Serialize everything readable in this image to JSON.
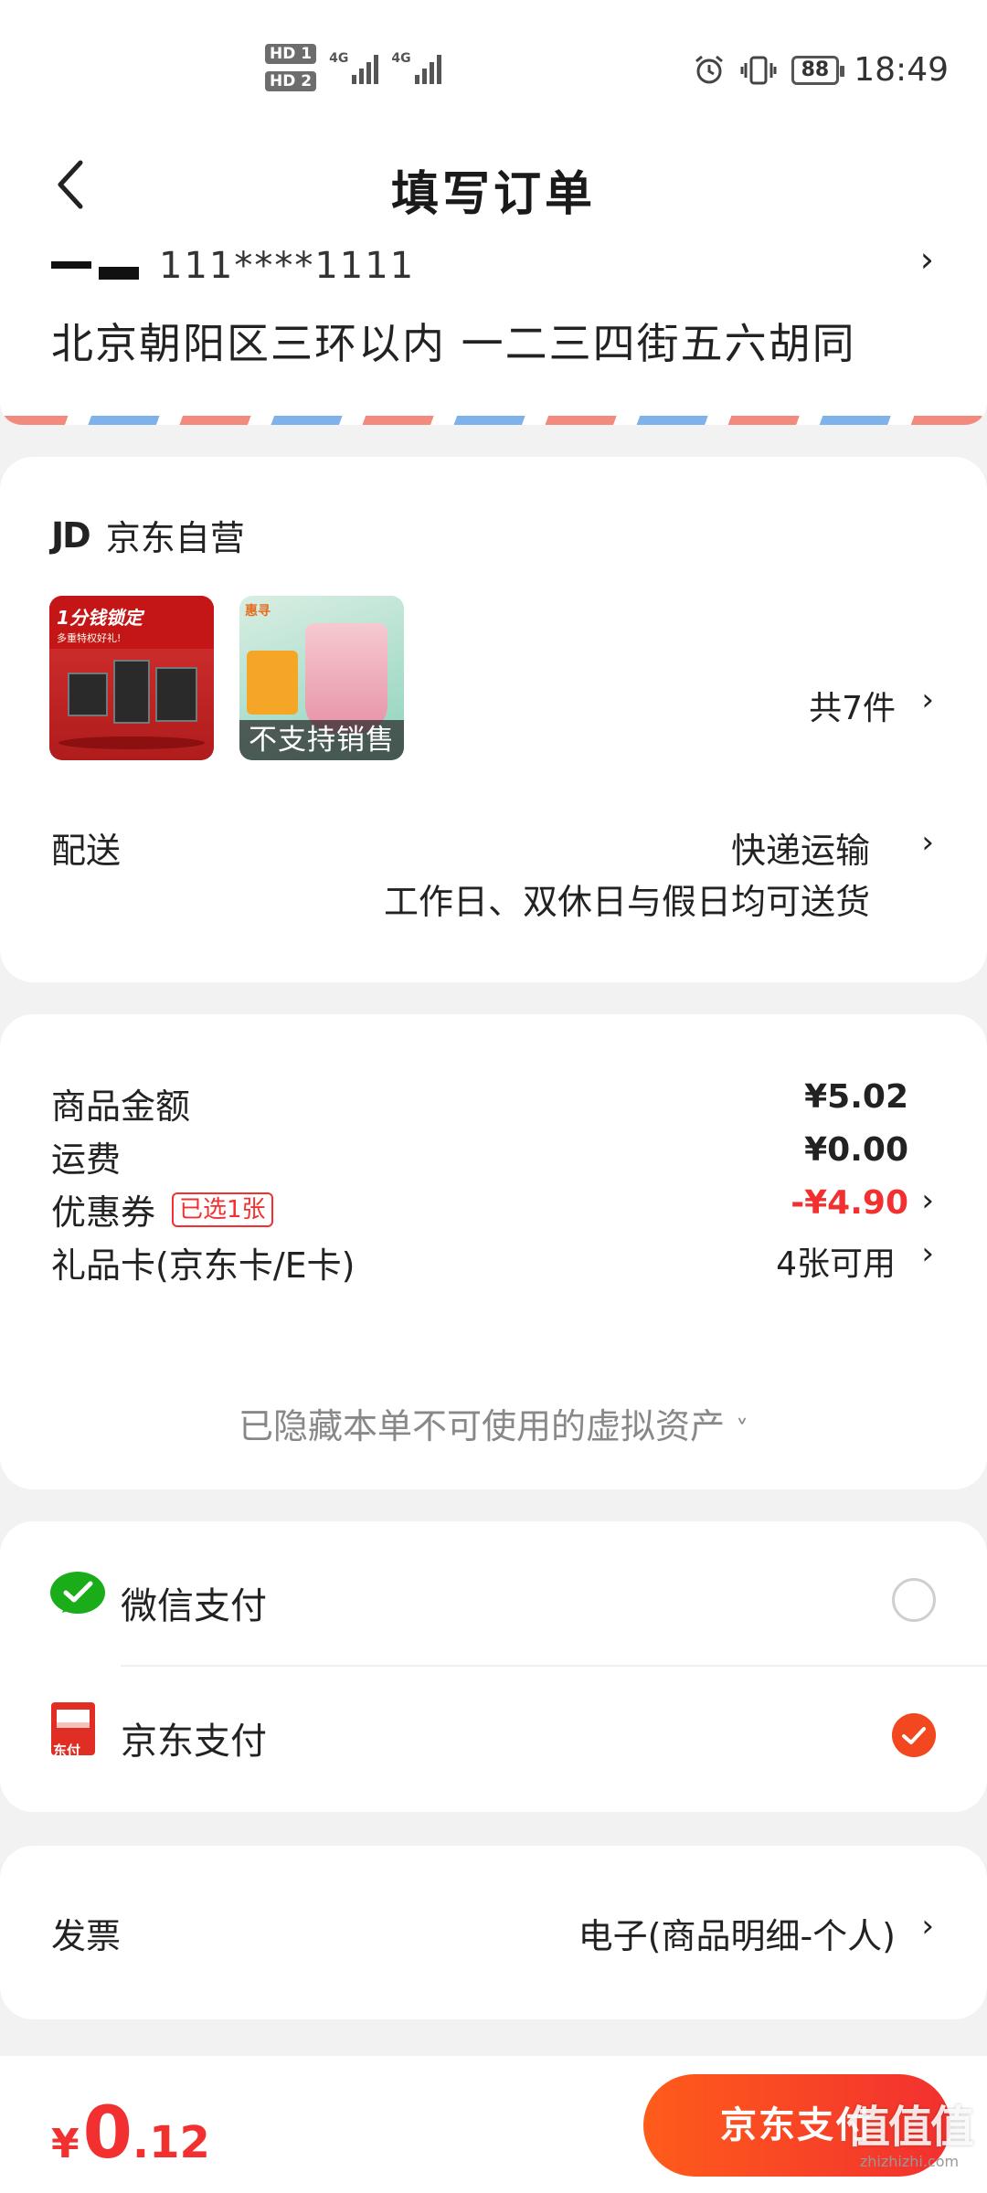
{
  "status_bar": {
    "hd1": "HD 1",
    "hd2": "HD 2",
    "net1": "4G",
    "net2": "4G",
    "battery": "88",
    "time": "18:49"
  },
  "header": {
    "title": "填写订单",
    "back_icon": "chevron-left-icon"
  },
  "address": {
    "phone": "111****1111",
    "line": "北京朝阳区三环以内 一二三四街五六胡同"
  },
  "shop": {
    "logo": "JD",
    "name": "京东自营",
    "thumbnails": [
      {
        "tag": "1分钱锁定",
        "subtag": "多重特权好礼!"
      },
      {
        "brand": "惠寻",
        "overlay": "不支持销售"
      }
    ],
    "item_count": "共7件",
    "delivery_label": "配送",
    "delivery_method": "快递运输",
    "delivery_note": "工作日、双休日与假日均可送货"
  },
  "price": {
    "rows": [
      {
        "label": "商品金额",
        "value": "¥5.02"
      },
      {
        "label": "运费",
        "value": "¥0.00"
      },
      {
        "label": "优惠券",
        "badge": "已选1张",
        "value": "-¥4.90"
      },
      {
        "label": "礼品卡(京东卡/E卡)",
        "value": "4张可用"
      }
    ],
    "hidden_note": "已隐藏本单不可使用的虚拟资产",
    "accent": "#f23030"
  },
  "payment": {
    "options": [
      {
        "label": "微信支付",
        "icon": "wechat-pay-icon",
        "selected": false
      },
      {
        "label": "京东支付",
        "icon": "jd-pay-icon",
        "icon_text": "东付",
        "selected": true
      }
    ]
  },
  "invoice": {
    "label": "发票",
    "value": "电子(商品明细-个人)"
  },
  "bottom": {
    "currency": "¥",
    "total_int": "0",
    "total_dec": ".12",
    "pay_button": "京东支付",
    "button_color": "#f2471f"
  },
  "watermark": {
    "mark": "值值值",
    "url": "zhizhizhi.com"
  }
}
